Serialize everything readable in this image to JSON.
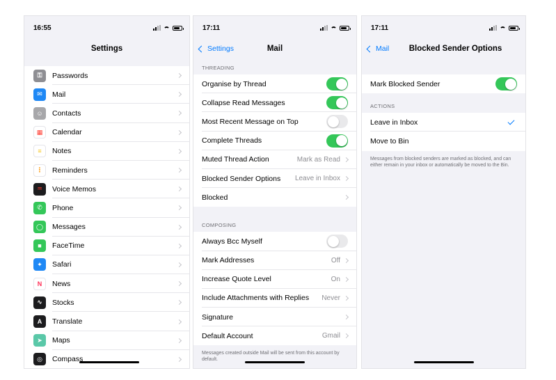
{
  "panel1": {
    "time": "16:55",
    "title": "Settings",
    "items": [
      {
        "label": "Passwords",
        "icon": "key-icon",
        "color": "#8e8e93"
      },
      {
        "label": "Mail",
        "icon": "mail-icon",
        "color": "#1e88f5"
      },
      {
        "label": "Contacts",
        "icon": "contacts-icon",
        "color": "#a7a7aa"
      },
      {
        "label": "Calendar",
        "icon": "calendar-icon",
        "color": "#ffffff"
      },
      {
        "label": "Notes",
        "icon": "notes-icon",
        "color": "#ffffff"
      },
      {
        "label": "Reminders",
        "icon": "reminders-icon",
        "color": "#ffffff"
      },
      {
        "label": "Voice Memos",
        "icon": "voice-memos-icon",
        "color": "#1c1c1e"
      },
      {
        "label": "Phone",
        "icon": "phone-icon",
        "color": "#34c759"
      },
      {
        "label": "Messages",
        "icon": "messages-icon",
        "color": "#34c759"
      },
      {
        "label": "FaceTime",
        "icon": "facetime-icon",
        "color": "#34c759"
      },
      {
        "label": "Safari",
        "icon": "safari-icon",
        "color": "#1e88f5"
      },
      {
        "label": "News",
        "icon": "news-icon",
        "color": "#ffffff"
      },
      {
        "label": "Stocks",
        "icon": "stocks-icon",
        "color": "#1c1c1e"
      },
      {
        "label": "Translate",
        "icon": "translate-icon",
        "color": "#1c1c1e"
      },
      {
        "label": "Maps",
        "icon": "maps-icon",
        "color": "#5ac8a8"
      },
      {
        "label": "Compass",
        "icon": "compass-icon",
        "color": "#1c1c1e"
      }
    ]
  },
  "panel2": {
    "time": "17:11",
    "back": "Settings",
    "title": "Mail",
    "threading_header": "THREADING",
    "threading": [
      {
        "label": "Organise by Thread",
        "toggle": true
      },
      {
        "label": "Collapse Read Messages",
        "toggle": true
      },
      {
        "label": "Most Recent Message on Top",
        "toggle": false
      },
      {
        "label": "Complete Threads",
        "toggle": true
      },
      {
        "label": "Muted Thread Action",
        "value": "Mark as Read"
      },
      {
        "label": "Blocked Sender Options",
        "value": "Leave in Inbox"
      },
      {
        "label": "Blocked",
        "value": ""
      }
    ],
    "composing_header": "COMPOSING",
    "composing": [
      {
        "label": "Always Bcc Myself",
        "toggle": false
      },
      {
        "label": "Mark Addresses",
        "value": "Off"
      },
      {
        "label": "Increase Quote Level",
        "value": "On"
      },
      {
        "label": "Include Attachments with Replies",
        "value": "Never"
      },
      {
        "label": "Signature",
        "value": ""
      },
      {
        "label": "Default Account",
        "value": "Gmail"
      }
    ],
    "footer": "Messages created outside Mail will be sent from this account by default."
  },
  "panel3": {
    "time": "17:11",
    "back": "Mail",
    "title": "Blocked Sender Options",
    "mark_label": "Mark Blocked Sender",
    "mark_on": true,
    "actions_header": "ACTIONS",
    "actions": [
      {
        "label": "Leave in Inbox",
        "checked": true
      },
      {
        "label": "Move to Bin",
        "checked": false
      }
    ],
    "footer": "Messages from blocked senders are marked as blocked, and can either remain in your inbox or automatically be moved to the Bin."
  },
  "colors": {
    "accent": "#007aff",
    "toggle_on": "#34c759"
  }
}
